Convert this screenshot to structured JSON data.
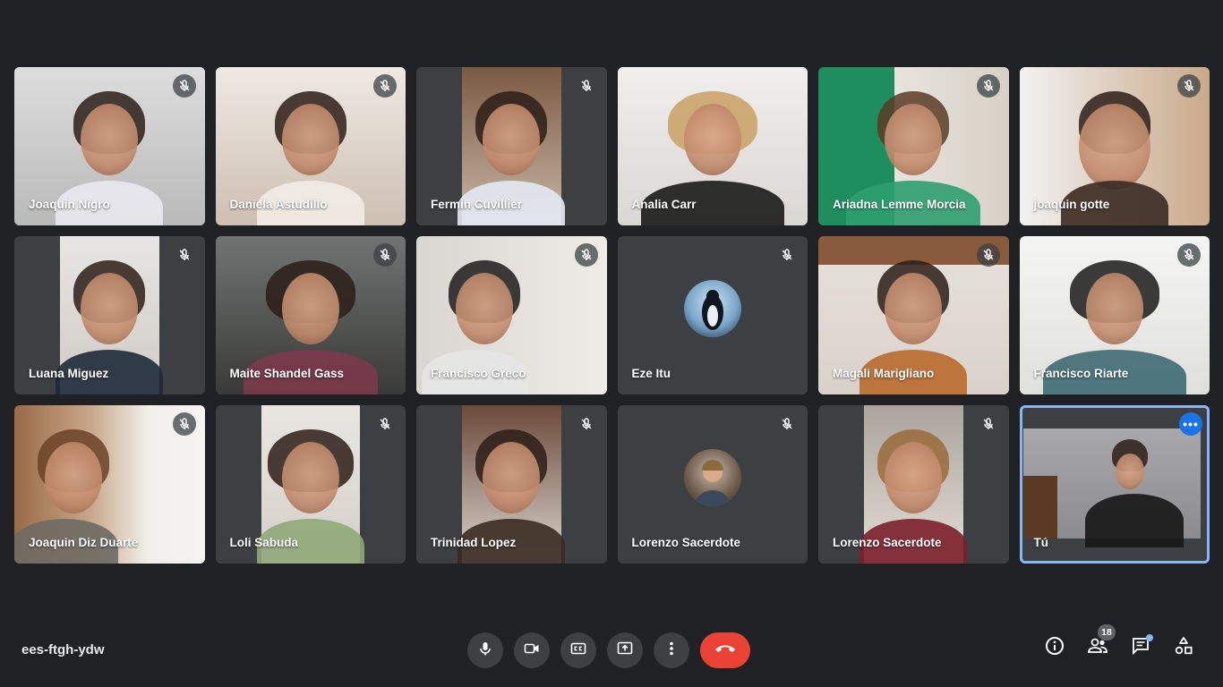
{
  "meeting": {
    "code": "ees-ftgh-ydw"
  },
  "colors": {
    "background": "#202124",
    "tile": "#3c4043",
    "accent": "#8ab4f8",
    "end_call": "#ea4335"
  },
  "participants": [
    {
      "name": "Joaquin Nigro",
      "muted": true
    },
    {
      "name": "Daniela Astudillo",
      "muted": true
    },
    {
      "name": "Fermin Cuvillier",
      "muted": true
    },
    {
      "name": "Analia Carr",
      "muted": false
    },
    {
      "name": "Ariadna Lemme Morcia",
      "muted": true
    },
    {
      "name": "joaquin gotte",
      "muted": true
    },
    {
      "name": "Luana Miguez",
      "muted": true
    },
    {
      "name": "Maite Shandel Gass",
      "muted": true
    },
    {
      "name": "Francisco Greco",
      "muted": true
    },
    {
      "name": "Eze Itu",
      "muted": true,
      "video": false
    },
    {
      "name": "Magali Marigliano",
      "muted": true
    },
    {
      "name": "Francisco Riarte",
      "muted": true
    },
    {
      "name": "Joaquin Diz Duarte",
      "muted": true
    },
    {
      "name": "Loli Sabuda",
      "muted": true
    },
    {
      "name": "Trinidad Lopez",
      "muted": true
    },
    {
      "name": "Lorenzo Sacerdote",
      "muted": true,
      "video": false
    },
    {
      "name": "Lorenzo Sacerdote",
      "muted": true
    },
    {
      "name": "Tú",
      "muted": false,
      "self": true
    }
  ],
  "controls": [
    "mic-icon",
    "camera-icon",
    "captions-icon",
    "present-icon",
    "more-vert-icon",
    "end-call-icon"
  ],
  "right_toolbar": {
    "icons": [
      "info-icon",
      "people-icon",
      "chat-icon",
      "activities-icon"
    ],
    "people_count": "18"
  }
}
